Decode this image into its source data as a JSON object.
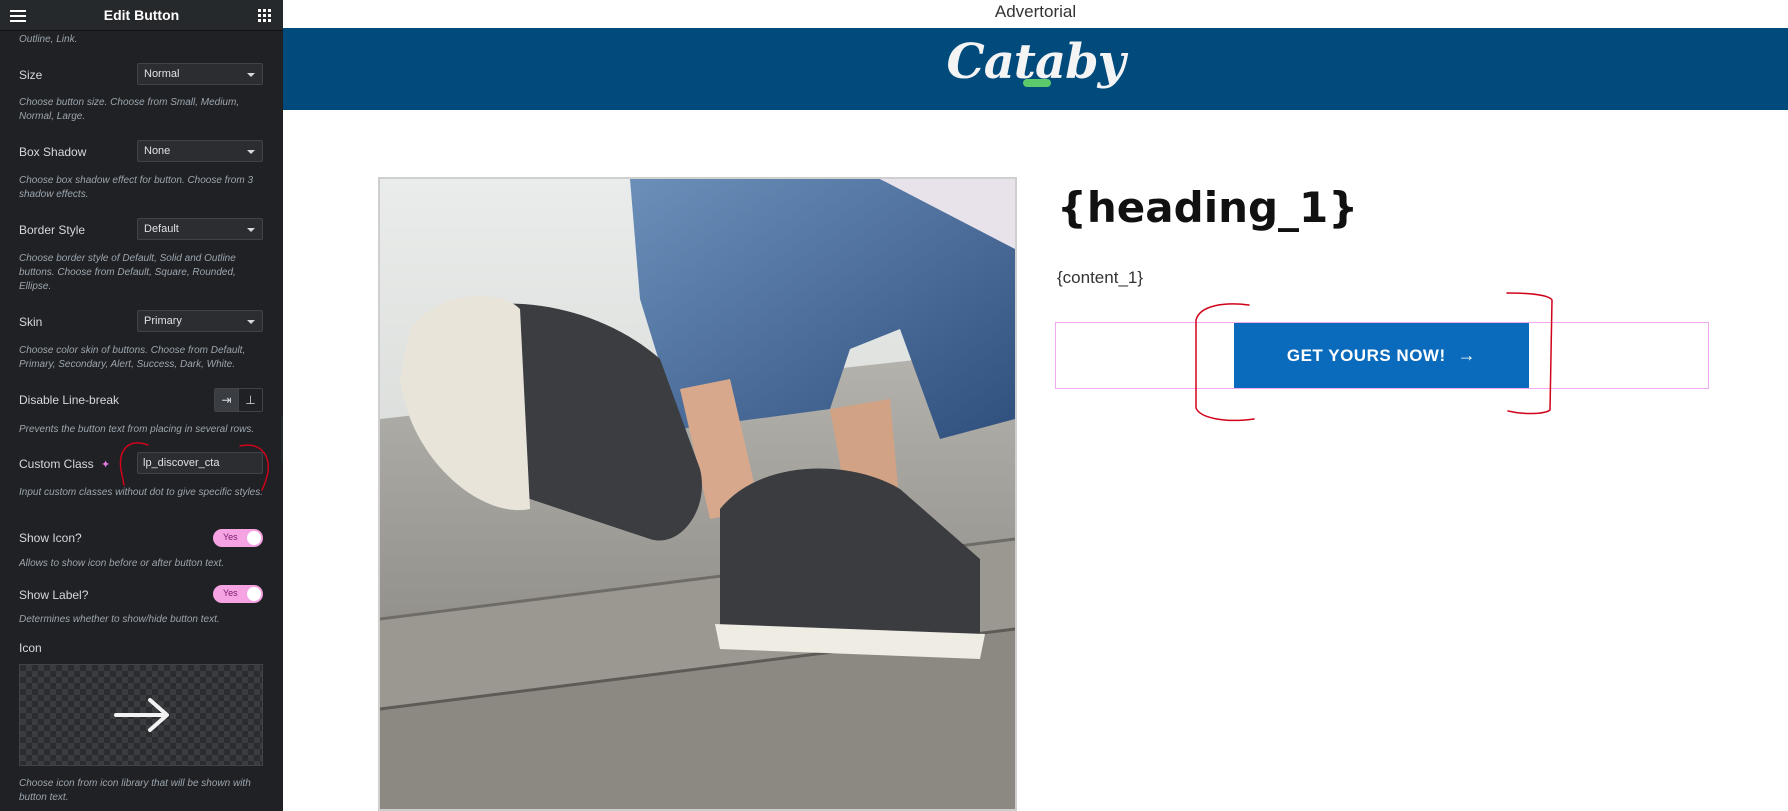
{
  "sidebar": {
    "title": "Edit Button",
    "skin_desc_tail": "Outline, Link.",
    "controls": {
      "size": {
        "label": "Size",
        "value": "Normal",
        "desc": "Choose button size. Choose from Small, Medium, Normal, Large."
      },
      "box_shadow": {
        "label": "Box Shadow",
        "value": "None",
        "desc": "Choose box shadow effect for button. Choose from 3 shadow effects."
      },
      "border_style": {
        "label": "Border Style",
        "value": "Default",
        "desc": "Choose border style of Default, Solid and Outline buttons. Choose from Default, Square, Rounded, Ellipse."
      },
      "skin": {
        "label": "Skin",
        "value": "Primary",
        "desc": "Choose color skin of buttons. Choose from Default, Primary, Secondary, Alert, Success, Dark, White."
      },
      "disable_line_break": {
        "label": "Disable Line-break",
        "desc": "Prevents the button text from placing in several rows."
      },
      "custom_class": {
        "label": "Custom Class",
        "value": "lp_discover_cta",
        "desc": "Input custom classes without dot to give specific styles."
      },
      "show_icon": {
        "label": "Show Icon?",
        "toggle": "Yes",
        "desc": "Allows to show icon before or after button text."
      },
      "show_label": {
        "label": "Show Label?",
        "toggle": "Yes",
        "desc": "Determines whether to show/hide button text."
      },
      "icon": {
        "label": "Icon",
        "desc": "Choose icon from icon library that will be shown with button text."
      }
    }
  },
  "preview": {
    "advertorial": "Advertorial",
    "logo": "Cataby",
    "heading": "{heading_1}",
    "content": "{content_1}",
    "cta_label": "GET YOURS NOW!"
  },
  "colors": {
    "sidebar_bg": "#1f2124",
    "brand_bar": "#004a7c",
    "cta_bg": "#0a6bbd",
    "toggle_on": "#f5a3e3",
    "annotation": "#d0021b"
  },
  "icons": [
    "hamburger-icon",
    "apps-grid-icon",
    "ai-sparkle-icon",
    "arrow-right-icon",
    "chevron-left-icon"
  ]
}
